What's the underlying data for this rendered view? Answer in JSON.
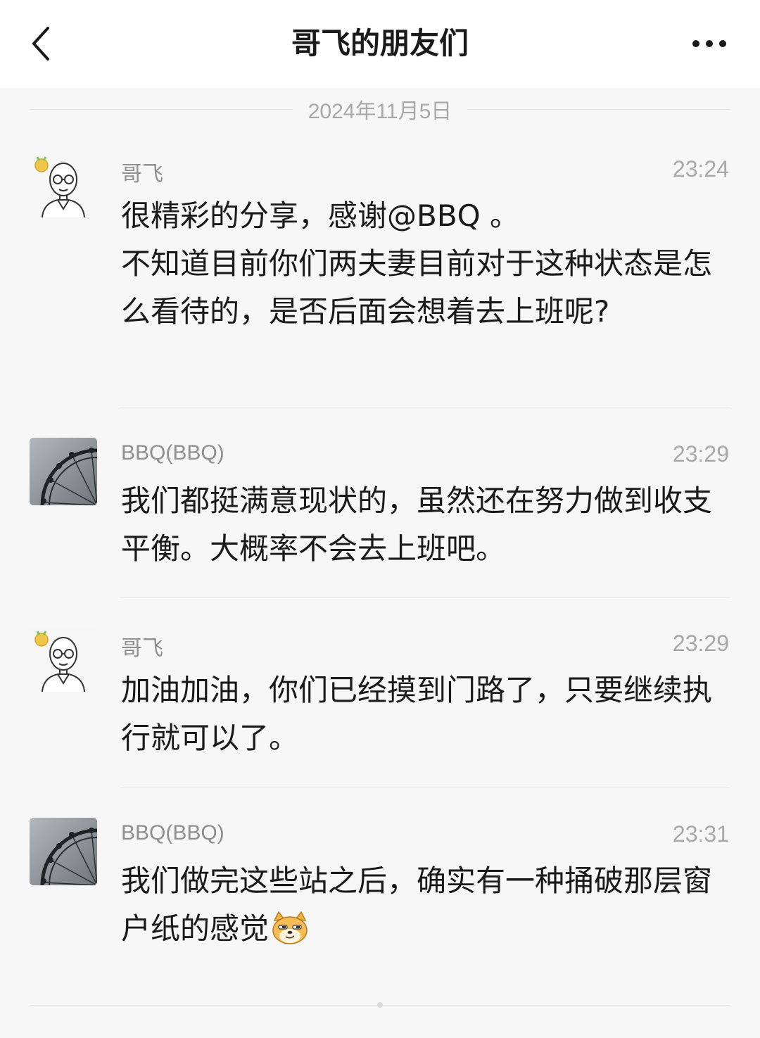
{
  "header": {
    "title": "哥飞的朋友们",
    "back_icon": "chevron-left-icon",
    "more_icon": "more-dots-icon"
  },
  "date_separator": "2024年11月5日",
  "messages": [
    {
      "sender": "哥飞",
      "time": "23:24",
      "avatar": "cartoon-man-with-glasses-avatar",
      "text": "很精彩的分享，感谢@BBQ 。\n不知道目前你们两夫妻目前对于这种状态是怎么看待的，是否后面会想着去上班呢?"
    },
    {
      "sender": "BBQ(BBQ)",
      "time": "23:29",
      "avatar": "ferris-wheel-photo-avatar",
      "text": "我们都挺满意现状的，虽然还在努力做到收支平衡。大概率不会去上班吧。"
    },
    {
      "sender": "哥飞",
      "time": "23:29",
      "avatar": "cartoon-man-with-glasses-avatar",
      "text": "加油加油，你们已经摸到门路了，只要继续执行就可以了。"
    },
    {
      "sender": "BBQ(BBQ)",
      "time": "23:31",
      "avatar": "ferris-wheel-photo-avatar",
      "text": "我们做完这些站之后，确实有一种捅破那层窗户纸的感觉",
      "emoji": "smirking-doge-emoji-icon"
    }
  ],
  "colors": {
    "background": "#f7f7f7",
    "header_bg": "#ffffff",
    "primary_text": "#1a1a1a",
    "secondary_text": "#8f8f8f",
    "meta_text": "#a8a8a8",
    "divider": "#e6e6e6"
  }
}
